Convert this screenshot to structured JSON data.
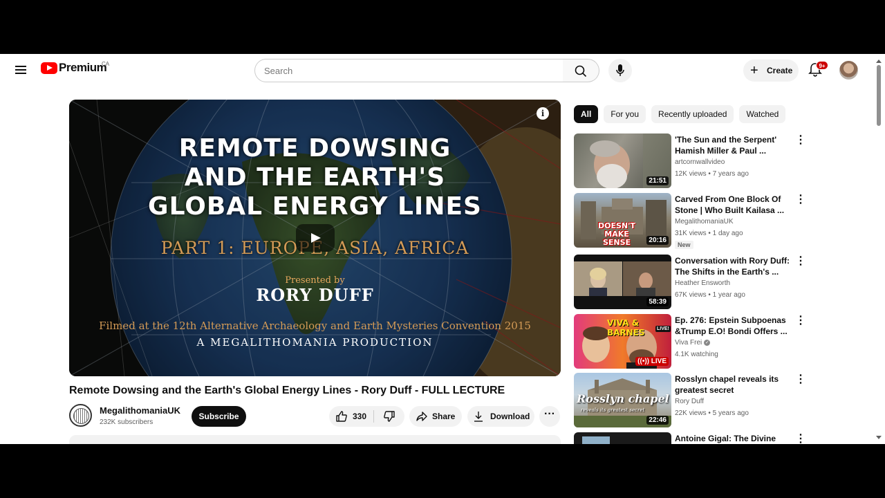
{
  "header": {
    "logo_text": "Premium",
    "region": "CA",
    "search_placeholder": "Search",
    "create_label": "Create",
    "notification_count": "9+"
  },
  "video": {
    "overlay_title_lines": [
      "REMOTE DOWSING",
      "AND THE EARTH'S",
      "GLOBAL ENERGY LINES"
    ],
    "overlay_part": "PART 1: EUROPE, ASIA, AFRICA",
    "overlay_presented_by": "Presented by",
    "overlay_presenter": "RORY DUFF",
    "overlay_filmed": "Filmed at the 12th Alternative Archaeology and Earth Mysteries Convention 2015",
    "overlay_production": "A MEGALITHOMANIA PRODUCTION",
    "title": "Remote Dowsing and the Earth's Global Energy Lines - Rory Duff - FULL LECTURE",
    "channel_name": "MegalithomaniaUK",
    "subscribers": "232K subscribers",
    "subscribe_label": "Subscribe",
    "likes": "330",
    "share_label": "Share",
    "download_label": "Download"
  },
  "filters": [
    "All",
    "For you",
    "Recently uploaded",
    "Watched"
  ],
  "recommendations": [
    {
      "title": "'The Sun and the Serpent' Hamish Miller & Paul ...",
      "channel": "artcornwallvideo",
      "meta": "12K views • 7 years ago",
      "duration": "21:51",
      "thumb_icon": "bearded-man-thumbnail"
    },
    {
      "title": "Carved From One Block Of Stone | Who Built Kailasa ...",
      "channel": "MegalithomaniaUK",
      "meta": "31K views • 1 day ago",
      "duration": "20:16",
      "badge": "New",
      "thumb_text": "DOESN'T MAKE SENSE",
      "thumb_icon": "temple-thumbnail"
    },
    {
      "title": "Conversation with Rory Duff: The Shifts in the Earth's ...",
      "channel": "Heather Ensworth",
      "meta": "67K views • 1 year ago",
      "duration": "58:39",
      "thumb_icon": "video-call-thumbnail"
    },
    {
      "title": "Ep. 276: Epstein Subpoenas &Trump E.O!  Bondi Offers ...",
      "channel": "Viva Frei",
      "meta": "4.1K watching",
      "duration": "LIVE",
      "thumb_text": "VIVA & BARNES",
      "thumb_badge": "LIVE!",
      "thumb_icon": "podcast-thumbnail"
    },
    {
      "title": "Rosslyn chapel reveals its greatest secret",
      "channel": "Rory Duff",
      "meta": "22K views • 5 years ago",
      "duration": "22:46",
      "thumb_text": "Rosslyn chapel",
      "thumb_sub": "reveals its greatest secret",
      "thumb_icon": "chapel-thumbnail"
    },
    {
      "title": "Antoine Gigal: The Divine Island",
      "thumb_icon": "island-thumbnail"
    }
  ],
  "colors": {
    "brand_red": "#ff0000",
    "overlay_gold": "#d49b56",
    "chip_active": "#0f0f0f"
  }
}
